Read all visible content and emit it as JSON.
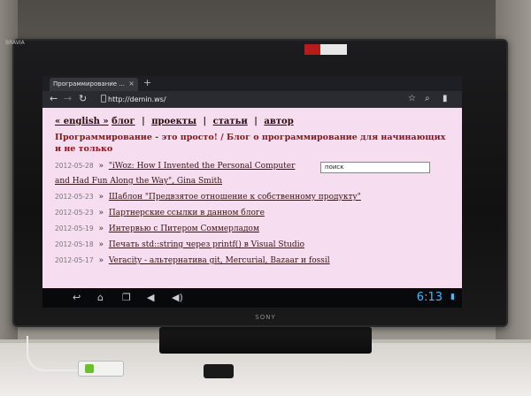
{
  "browser": {
    "tab_title": "Программирование ...",
    "tab_close": "×",
    "new_tab": "+",
    "url": "http://demin.ws/",
    "icons": [
      "back-icon",
      "forward-icon",
      "reload-icon",
      "star-icon",
      "search-icon",
      "bookmarks-icon"
    ]
  },
  "page": {
    "nav": {
      "english": "« english »",
      "blog": "блог",
      "projects": "проекты",
      "articles": "статьи",
      "author": "автор",
      "separator": "|"
    },
    "blog_title": "Программирование - это просто! / Блог о программирование для начинающих и не только",
    "search_placeholder": "поиск",
    "arrow": "»",
    "posts": [
      {
        "date": "2012-05-28",
        "title": "\"iWoz: How I Invented the Personal Computer"
      },
      {
        "date": "",
        "title": "and Had Fun Along the Way\", Gina Smith"
      },
      {
        "date": "2012-05-23",
        "title": "Шаблон \"Предвзятое отношение к собственному продукту\""
      },
      {
        "date": "2012-05-23",
        "title": "Партнерские ссылки в данном блоге"
      },
      {
        "date": "2012-05-19",
        "title": "Интервью с Питером Соммерладом"
      },
      {
        "date": "2012-05-18",
        "title": "Печать std::string через printf() в Visual Studio"
      },
      {
        "date": "2012-05-17",
        "title": "Veracity - альтернатива git, Mercurial, Bazaar и fossil"
      }
    ]
  },
  "system_bar": {
    "clock": "6:13",
    "icons": [
      "back-icon",
      "home-icon",
      "recents-icon",
      "volume-down-icon",
      "volume-up-icon",
      "status-icon"
    ]
  },
  "tv": {
    "brand": "SONY",
    "corner_label": "BRAVIA"
  }
}
